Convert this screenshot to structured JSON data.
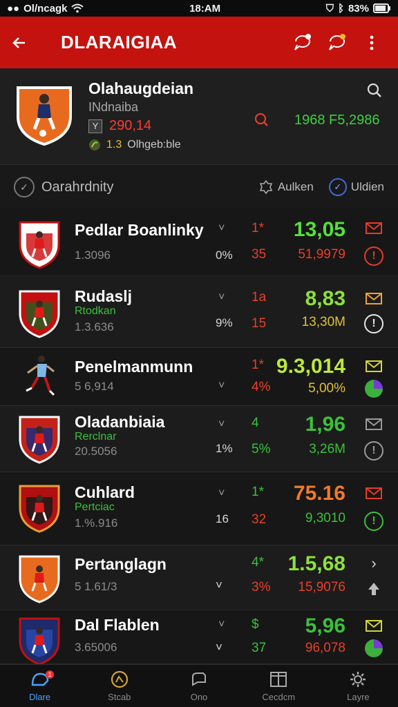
{
  "statusbar": {
    "carrier": "Ol/ncagk",
    "time": "18:AM",
    "battery": "83%"
  },
  "appbar": {
    "title": "DLARAIGIAA",
    "colors": {
      "bar": "#c4120f"
    }
  },
  "profile": {
    "name": "Olahaugdeian",
    "subtitle": "INdnaiba",
    "price_icon": "Y",
    "price": "290,14",
    "note_prefix": "1.3",
    "note": "Olhgeb:ble",
    "value": "1968 F5,2986"
  },
  "section": {
    "title": "Oarahrdnity",
    "action1": "Aulken",
    "action2": "Uldien"
  },
  "rows": [
    {
      "name": "Pedlar Boanlinky",
      "sub": "",
      "meta": "1.3096",
      "chev": "˅",
      "pct": "0%",
      "t1": "1*",
      "t2": "35",
      "big": "13,05",
      "small": "51,9979",
      "t1c": "#e8402a",
      "t2c": "#e8402a",
      "bigc": "#55e03c",
      "smallc": "#e8402a",
      "i1": "envelope",
      "i1c": "#e83a2a",
      "i2": "info",
      "i2c": "#e83a2a"
    },
    {
      "name": "Rudaslj",
      "sub": "Rtodkan",
      "meta": "1.3.636",
      "chev": "˅",
      "pct": "9%",
      "t1": "1a",
      "t2": "15",
      "big": "8,83",
      "small": "13,30M",
      "t1c": "#e8402a",
      "t2c": "#e8402a",
      "bigc": "#8ee03c",
      "smallc": "#e0c23a",
      "i1": "envelope",
      "i1c": "#f2a23a",
      "i2": "info",
      "i2c": "#e8e8e8"
    },
    {
      "name": "Penelmanmunn",
      "sub": "",
      "meta": "5 6,914",
      "chev": "˅",
      "pct": "",
      "t1": "1*",
      "t2": "4%",
      "big": "9.3,014",
      "small": "5,00%",
      "t1c": "#e8402a",
      "t2c": "#e8402a",
      "bigc": "#bde83c",
      "smallc": "#e0c23a",
      "i1": "envelope",
      "i1c": "#d4d43a",
      "i2": "pie",
      "i2c": "#3cb03c"
    },
    {
      "name": "Oladanbiaia",
      "sub": "Rerclnar",
      "meta": "20.5056",
      "chev": "˅",
      "pct": "1%",
      "t1": "4",
      "t2": "5%",
      "big": "1,96",
      "small": "3,26M",
      "t1c": "#3cc03c",
      "t2c": "#3cc03c",
      "bigc": "#3cc03c",
      "smallc": "#3cc03c",
      "i1": "envelope",
      "i1c": "#9a9a9a",
      "i2": "info",
      "i2c": "#9a9a9a"
    },
    {
      "name": "Cuhlard",
      "sub": "Pertciac",
      "meta": "1.%.916",
      "chev": "˅",
      "pct": "16",
      "t1": "1*",
      "t2": "32",
      "big": "75.16",
      "small": "9,3010",
      "t1c": "#3cc03c",
      "t2c": "#e8402a",
      "bigc": "#f07a2a",
      "smallc": "#3cc03c",
      "i1": "envelope",
      "i1c": "#e83a2a",
      "i2": "info",
      "i2c": "#3cc03c"
    },
    {
      "name": "Pertanglagn",
      "sub": "",
      "meta": "5 1.61/3",
      "chev": "",
      "pct": "˅",
      "t1": "4*",
      "t2": "3%",
      "big": "1.5,68",
      "small": "15,9076",
      "t1c": "#3cc03c",
      "t2c": "#e8402a",
      "bigc": "#8ee03c",
      "smallc": "#e8402a",
      "i1": "chevron",
      "i1c": "#d8d8d8",
      "i2": "arrow",
      "i2c": "#bdbdbd"
    },
    {
      "name": "Dal Flablen",
      "sub": "",
      "meta": "3.65006",
      "chev": "˅",
      "pct": "˅",
      "t1": "$",
      "t2": "37",
      "big": "5,96",
      "small": "96,078",
      "t1c": "#3cc03c",
      "t2c": "#3cc03c",
      "bigc": "#3cc03c",
      "smallc": "#e8402a",
      "i1": "envelope",
      "i1c": "#d4d43a",
      "i2": "pie",
      "i2c": "#3cb03c"
    }
  ],
  "nav": [
    {
      "label": "Dlare",
      "icon": "home-icon"
    },
    {
      "label": "Stcab",
      "icon": "stats-icon"
    },
    {
      "label": "Ono",
      "icon": "chat-icon"
    },
    {
      "label": "Cecdcm",
      "icon": "board-icon"
    },
    {
      "label": "Layre",
      "icon": "settings-icon"
    }
  ],
  "nav_badge": "1"
}
